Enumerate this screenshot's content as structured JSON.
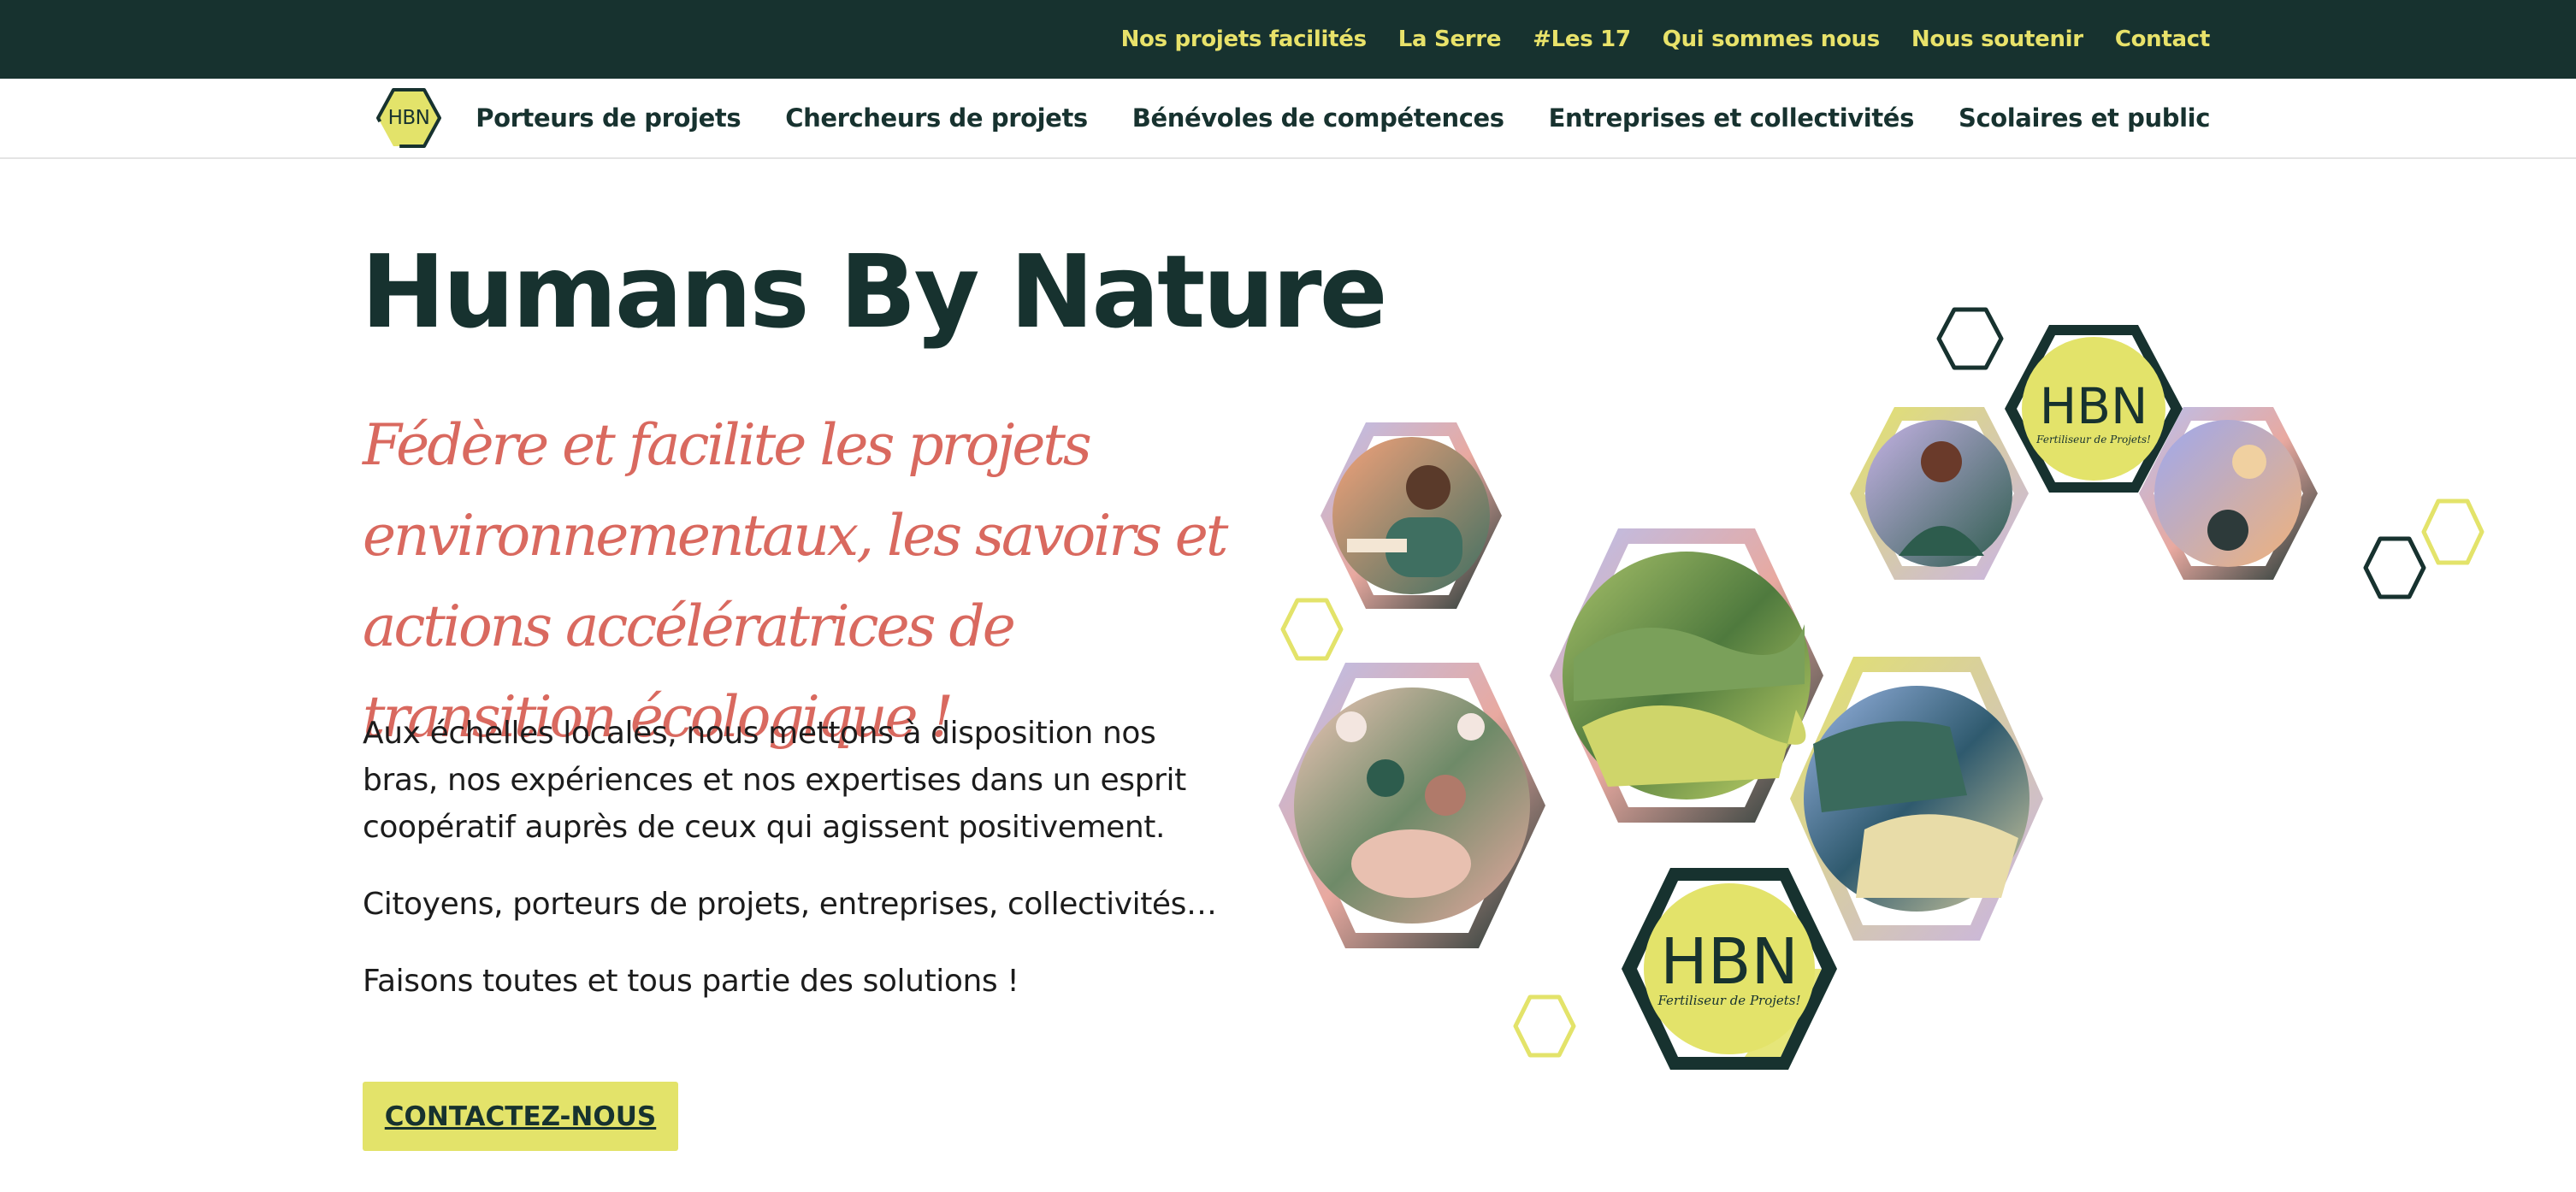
{
  "topnav": {
    "items": [
      {
        "label": "Nos projets facilités"
      },
      {
        "label": "La Serre"
      },
      {
        "label": "#Les 17"
      },
      {
        "label": "Qui sommes nous"
      },
      {
        "label": "Nous soutenir"
      },
      {
        "label": "Contact"
      }
    ]
  },
  "header": {
    "logo_text": "HBN",
    "nav": [
      {
        "label": "Porteurs de projets"
      },
      {
        "label": "Chercheurs de projets"
      },
      {
        "label": "Bénévoles de compétences"
      },
      {
        "label": "Entreprises et collectivités"
      },
      {
        "label": "Scolaires et public"
      }
    ]
  },
  "hero": {
    "title": "Humans By Nature",
    "tagline": "Fédère et facilite les projets environnementaux, les savoirs et actions accélératrices de transition écologique !",
    "paragraph1": "Aux échelles locales, nous mettons à disposition nos bras, nos expériences et nos expertises dans un esprit coopératif auprès de ceux qui agissent positivement.",
    "paragraph2": "Citoyens, porteurs de projets, entreprises, collectivités…",
    "paragraph3": "Faisons toutes et tous partie des solutions !",
    "cta_label": "CONTACTEZ-NOUS"
  },
  "illustration": {
    "badge_title": "HBN",
    "badge_subtitle": "Fertiliseur de Projets!"
  },
  "colors": {
    "dark_green": "#17322f",
    "yellow": "#e3e36a",
    "coral": "#d9695f",
    "text": "#1c1c1c"
  }
}
